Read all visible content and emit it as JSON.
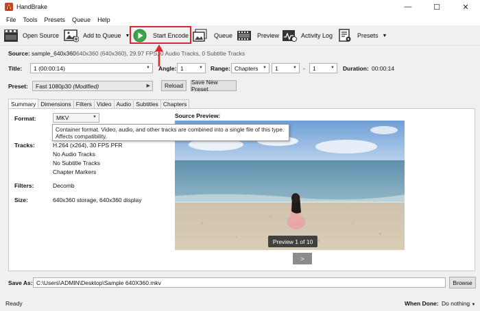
{
  "window": {
    "title": "HandBrake"
  },
  "menu": [
    "File",
    "Tools",
    "Presets",
    "Queue",
    "Help"
  ],
  "toolbar": {
    "open_source": "Open Source",
    "add_to_queue": "Add to Queue",
    "start_encode": "Start Encode",
    "queue": "Queue",
    "preview": "Preview",
    "activity_log": "Activity Log",
    "presets": "Presets"
  },
  "source": {
    "label": "Source:",
    "name": "sample_640x360",
    "info": "640x360 (640x360), 29.97 FPS, 0 Audio Tracks, 0 Subtitle Tracks"
  },
  "title_row": {
    "title_label": "Title:",
    "title_value": "1 (00:00:14)",
    "angle_label": "Angle:",
    "angle_value": "1",
    "range_label": "Range:",
    "range_type": "Chapters",
    "range_start": "1",
    "range_sep": "-",
    "range_end": "1",
    "duration_label": "Duration:",
    "duration_value": "00:00:14"
  },
  "preset": {
    "label": "Preset:",
    "value": "Fast 1080p30",
    "modifier": "(Modified)",
    "reload": "Reload",
    "save_new": "Save New Preset"
  },
  "tabs": [
    "Summary",
    "Dimensions",
    "Filters",
    "Video",
    "Audio",
    "Subtitles",
    "Chapters"
  ],
  "summary": {
    "format_label": "Format:",
    "format_value": "MKV",
    "tooltip_line1": "Container format. Video, audio, and other tracks are combined into a single file of this type.",
    "tooltip_line2": "Affects compatibility.",
    "tracks_label": "Tracks:",
    "tracks": [
      "H.264 (x264), 30 FPS PFR",
      "No Audio Tracks",
      "No Subtitle Tracks",
      "Chapter Markers"
    ],
    "filters_label": "Filters:",
    "filters_value": "Decomb",
    "size_label": "Size:",
    "size_value": "640x360 storage, 640x360 display",
    "source_preview_label": "Source Preview:",
    "preview_badge": "Preview 1 of 10",
    "next": ">"
  },
  "save_as": {
    "label": "Save As:",
    "path": "C:\\Users\\ADMIN\\Desktop\\Sample 640X360.mkv",
    "browse": "Browse"
  },
  "status": {
    "ready": "Ready",
    "when_done_label": "When Done:",
    "when_done_value": "Do nothing"
  },
  "colors": {
    "highlight": "#d9272e",
    "accent_green": "#3aa64a"
  }
}
